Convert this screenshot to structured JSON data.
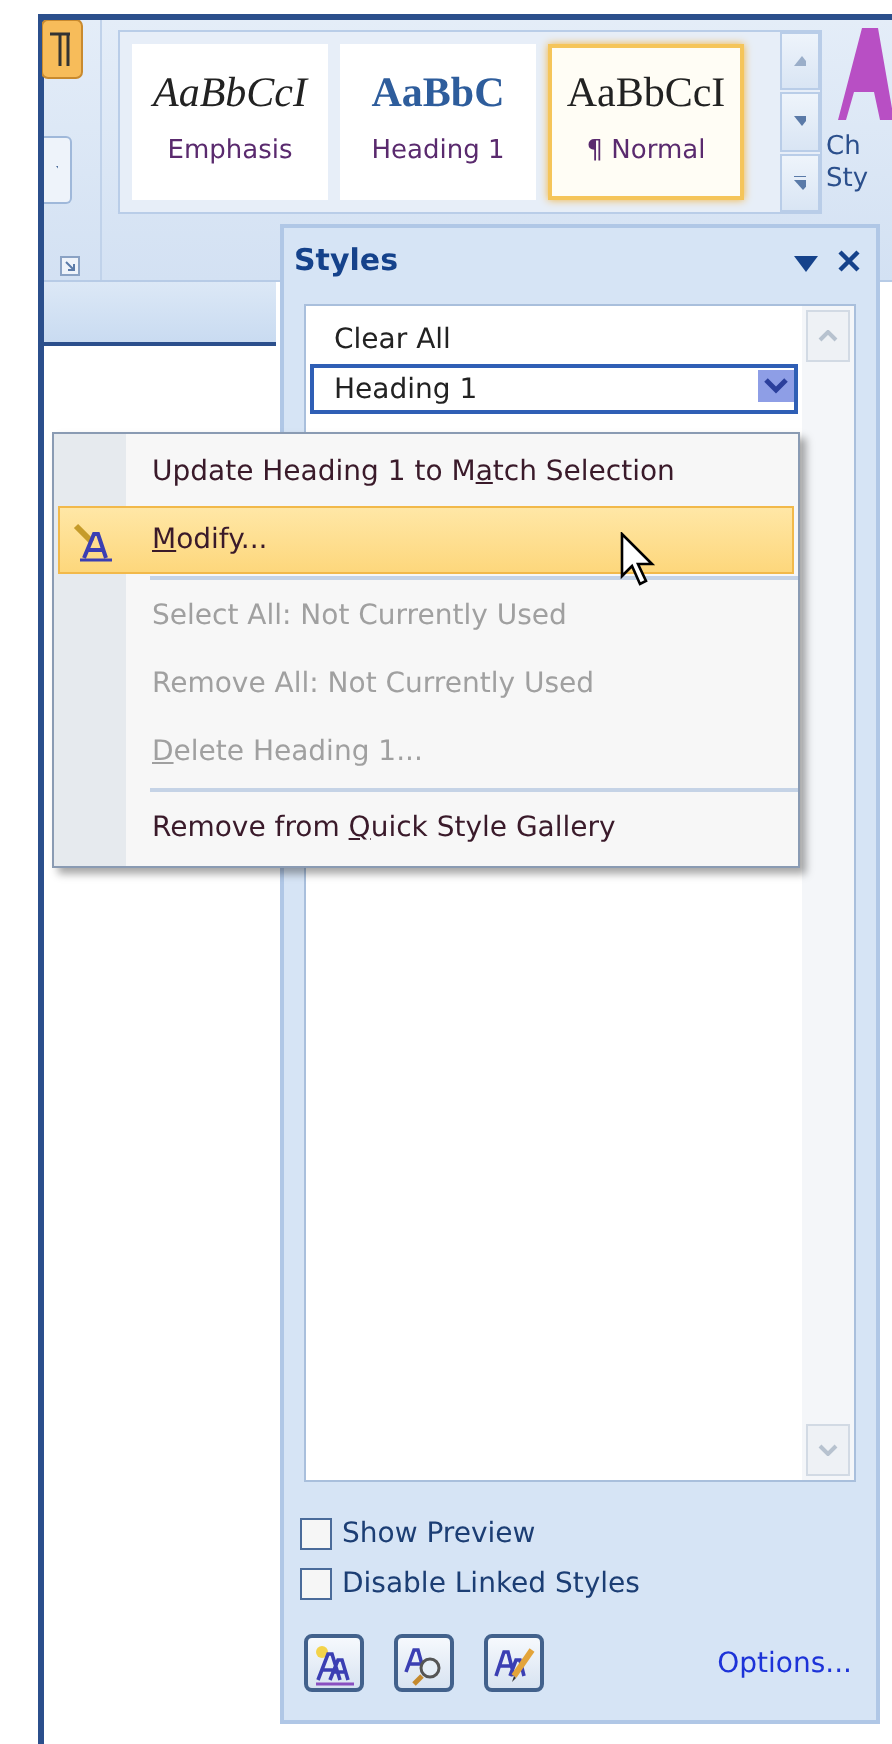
{
  "ribbon": {
    "gallery": [
      {
        "preview": "AaBbCcI",
        "name": "Emphasis",
        "kind": "emphasis",
        "selected": false
      },
      {
        "preview": "AaBbC",
        "name": "Heading 1",
        "kind": "heading",
        "selected": false
      },
      {
        "preview": "AaBbCcI",
        "name": "¶ Normal",
        "kind": "normal",
        "selected": true
      }
    ],
    "change_styles_label": [
      "Ch",
      "Sty"
    ]
  },
  "styles_pane": {
    "title": "Styles",
    "list": [
      {
        "label": "Clear All",
        "selected": false
      },
      {
        "label": "Heading 1",
        "selected": true
      }
    ],
    "checkboxes": [
      {
        "label": "Show Preview",
        "checked": false
      },
      {
        "label": "Disable Linked Styles",
        "checked": false
      }
    ],
    "buttons": [
      {
        "kind": "new"
      },
      {
        "kind": "inspect"
      },
      {
        "kind": "manage"
      }
    ],
    "options_link": "Options..."
  },
  "context_menu": {
    "items": [
      {
        "kind": "item",
        "before": "Update Heading 1 to M",
        "key": "a",
        "after": "tch Selection",
        "disabled": false,
        "selected": false
      },
      {
        "kind": "icon_item",
        "key": "M",
        "after": "odify...",
        "disabled": false,
        "selected": true
      },
      {
        "kind": "separator"
      },
      {
        "kind": "item",
        "before": "Select All: Not Currently Used",
        "disabled": true,
        "selected": false
      },
      {
        "kind": "item",
        "before": "Remove All: Not Currently Used",
        "disabled": true,
        "selected": false
      },
      {
        "kind": "item",
        "key": "D",
        "after": "elete Heading 1...",
        "disabled": true,
        "selected": false
      },
      {
        "kind": "separator"
      },
      {
        "kind": "item",
        "before": "Remove from ",
        "key": "Q",
        "after": "uick Style Gallery",
        "disabled": false,
        "selected": false
      }
    ]
  }
}
